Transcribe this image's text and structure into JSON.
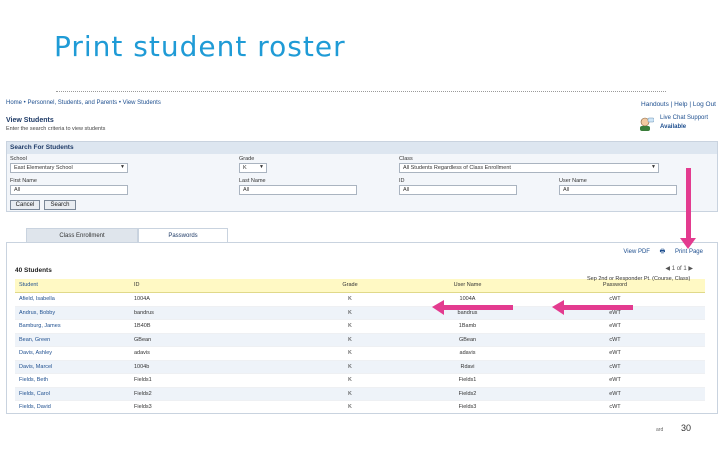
{
  "slide": {
    "title": "Print student roster",
    "page_number": "30",
    "footer_mark": "ard"
  },
  "app": {
    "breadcrumb": "Home • Personnel, Students, and Parents • View Students",
    "top_links": [
      "Handouts",
      "Help",
      "Log Out"
    ],
    "page_title": "View Students",
    "page_subtitle": "Enter the search criteria to view students",
    "support": {
      "line1": "Live Chat Support",
      "line2": "Available"
    }
  },
  "search": {
    "heading": "Search For Students",
    "school": {
      "label": "School",
      "value": "East Elementary School"
    },
    "grade": {
      "label": "Grade",
      "value": "K"
    },
    "class": {
      "label": "Class",
      "value": "All Students Regardless of Class Enrollment"
    },
    "first_name": {
      "label": "First Name",
      "value": "All"
    },
    "last_name": {
      "label": "Last Name",
      "value": "All"
    },
    "id": {
      "label": "ID",
      "value": "All"
    },
    "username": {
      "label": "User Name",
      "value": "All"
    },
    "cancel_label": "Cancel",
    "search_label": "Search"
  },
  "tabs": [
    {
      "label": "Class Enrollment",
      "active": false
    },
    {
      "label": "Passwords",
      "active": true
    }
  ],
  "results": {
    "view_pdf": "View PDF",
    "print_page": "Print Page",
    "count_label": "40 Students",
    "pager": "1 of 1",
    "sort_note": "Sep 2nd or Responder Pt. (Course, Class)",
    "columns": [
      "Student",
      "ID",
      "Grade",
      "User Name",
      "Password"
    ],
    "rows": [
      [
        "Afield, Isabella",
        "1004A",
        "K",
        "1004A",
        "cWT"
      ],
      [
        "Andrus, Bobby",
        "bandrus",
        "K",
        "bandrus",
        "eWT"
      ],
      [
        "Bamburg, James",
        "1B40B",
        "K",
        "1Bamb",
        "eWT"
      ],
      [
        "Bean, Green",
        "GBean",
        "K",
        "GBean",
        "cWT"
      ],
      [
        "Davis, Ashley",
        "adavis",
        "K",
        "adavis",
        "eWT"
      ],
      [
        "Davis, Marcel",
        "1004b",
        "K",
        "Rdavi",
        "cWT"
      ],
      [
        "Fields, Beth",
        "Fields1",
        "K",
        "Fields1",
        "eWT"
      ],
      [
        "Fields, Carol",
        "Fields2",
        "K",
        "Fields2",
        "eWT"
      ],
      [
        "Fields, David",
        "Fields3",
        "K",
        "Fields3",
        "cWT"
      ]
    ]
  },
  "colors": {
    "title_blue": "#1f9bd6",
    "highlight_arrow": "#e33b8f",
    "header_yellow": "#fff9c4"
  }
}
